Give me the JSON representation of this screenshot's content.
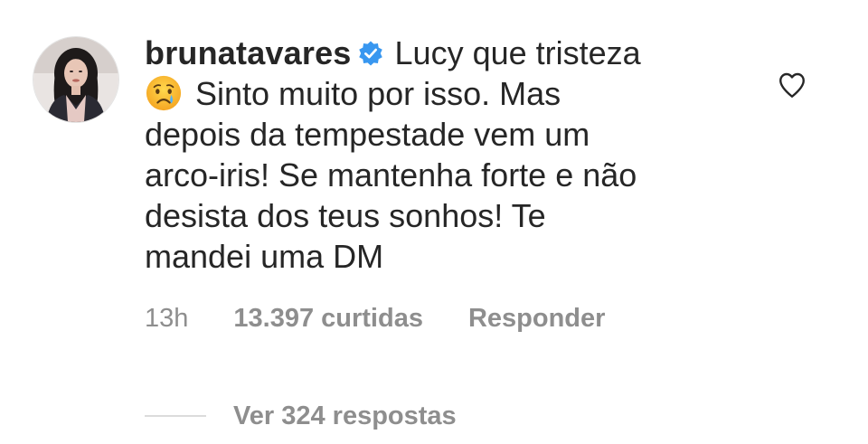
{
  "comment": {
    "username": "brunatavares",
    "verified": true,
    "text_first": "Lucy que tristeza",
    "text_lines": [
      "Sinto muito por isso. Mas",
      "depois da tempestade vem um",
      "arco-iris! Se mantenha forte e não",
      "desista dos teus sonhos! Te",
      "mandei uma DM"
    ],
    "emoji_icon": "crying-face-emoji",
    "like_icon": "heart-outline-icon"
  },
  "meta": {
    "time": "13h",
    "likes": "13.397 curtidas",
    "reply": "Responder"
  },
  "replies": {
    "label": "Ver 324 respostas"
  },
  "colors": {
    "text": "#262626",
    "secondary": "#8e8e8e",
    "verified_blue": "#3897f0",
    "divider": "#dbdbdb"
  }
}
